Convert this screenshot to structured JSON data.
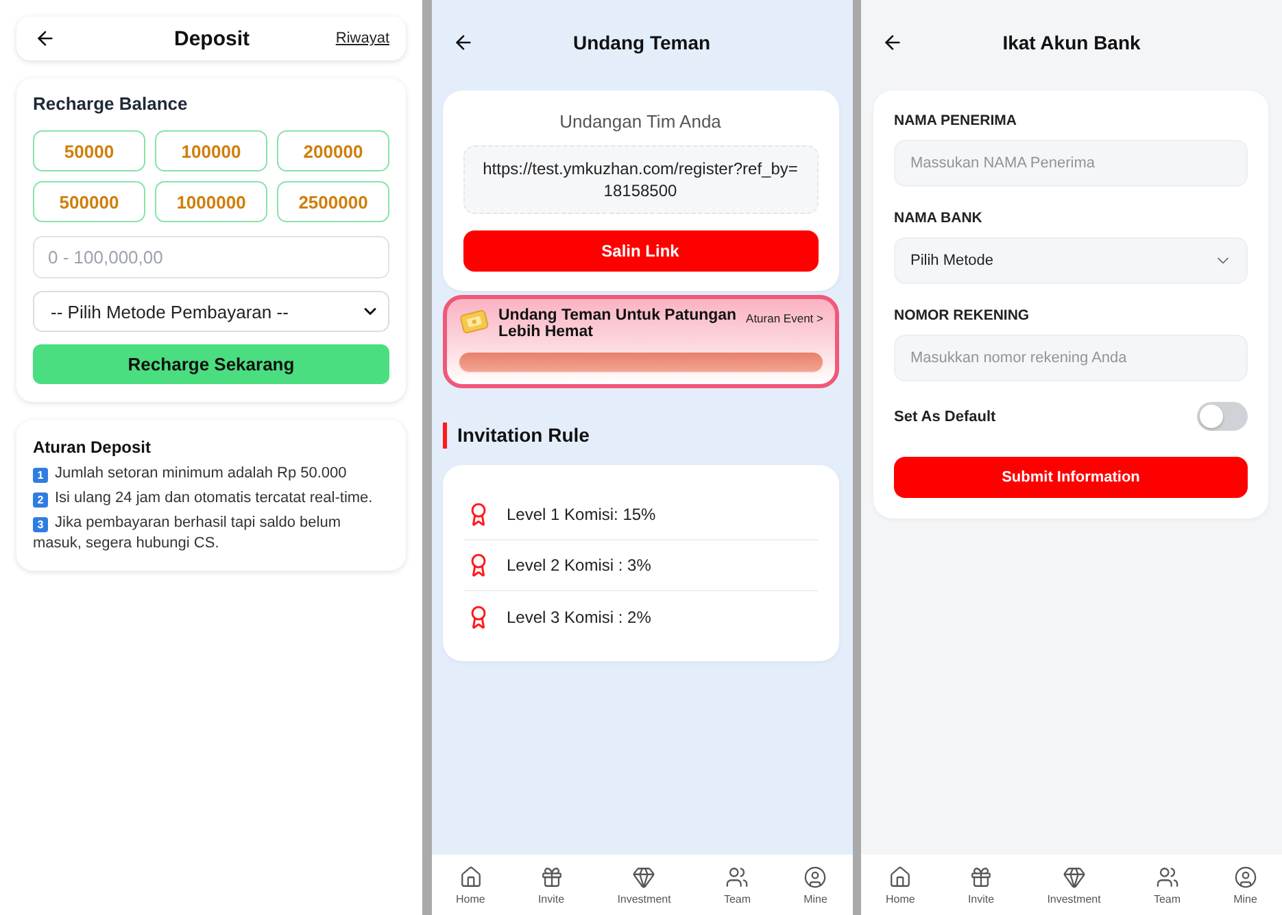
{
  "deposit_screen": {
    "header": {
      "title": "Deposit",
      "history_link": "Riwayat"
    },
    "recharge_card": {
      "title": "Recharge Balance",
      "amounts": [
        {
          "label": "50000",
          "selected": false
        },
        {
          "label": "100000",
          "selected": false
        },
        {
          "label": "200000",
          "selected": false
        },
        {
          "label": "500000",
          "selected": false
        },
        {
          "label": "1000000",
          "selected": false
        },
        {
          "label": "2500000",
          "selected": false
        }
      ],
      "amount_field": {
        "placeholder": "0 - 100,000,00"
      },
      "payment_method": {
        "value": "-- Pilih Metode Pembayaran --"
      },
      "submit_button": "Recharge Sekarang"
    },
    "rules_card": {
      "title": "Aturan Deposit",
      "items": [
        {
          "number": "1",
          "text": "Jumlah setoran minimum adalah Rp 50.000"
        },
        {
          "number": "2",
          "text": "Isi ulang 24 jam dan otomatis tercatat real-time."
        },
        {
          "number": "3",
          "text": "Jika pembayaran berhasil tapi saldo belum masuk, segera hubungi CS."
        }
      ]
    }
  },
  "invite_screen": {
    "header": {
      "title": "Undang Teman"
    },
    "invite_card": {
      "title": "Undangan Tim Anda",
      "link": "https://test.ymkuzhan.com/register?ref_by=18158500",
      "copy_button": "Salin Link"
    },
    "event_banner": {
      "title": "Undang Teman Untuk Patungan Lebih Hemat",
      "rules_link": "Aturan Event >",
      "level": 1
    },
    "invitation_rule": {
      "title": "Invitation Rule",
      "items": [
        "Level 1 Komisi: 15%",
        "Level 2 Komisi : 3%",
        "Level 3 Komisi : 2%"
      ]
    },
    "nav": [
      {
        "kind": "home",
        "label": "Home",
        "selected": false
      },
      {
        "kind": "invite",
        "label": "Invite",
        "selected": false
      },
      {
        "kind": "investment",
        "label": "Investment",
        "selected": false
      },
      {
        "kind": "team",
        "label": "Team",
        "selected": false
      },
      {
        "kind": "mine",
        "label": "Mine",
        "selected": false
      }
    ]
  },
  "bank_screen": {
    "header": {
      "title": "Ikat Akun Bank"
    },
    "form": {
      "fields": [
        {
          "kind": "input",
          "label": "NAMA PENERIMA",
          "placeholder": "Massukan NAMA Penerima"
        },
        {
          "kind": "select",
          "label": "NAMA BANK",
          "value": "Pilih Metode"
        },
        {
          "kind": "input",
          "label": "NOMOR REKENING",
          "placeholder": "Masukkan nomor rekening Anda"
        }
      ],
      "default_toggle": {
        "label": "Set As Default",
        "on": false
      },
      "submit_button": "Submit Information"
    },
    "nav": [
      {
        "kind": "home",
        "label": "Home",
        "selected": false
      },
      {
        "kind": "invite",
        "label": "Invite",
        "selected": false
      },
      {
        "kind": "investment",
        "label": "Investment",
        "selected": false
      },
      {
        "kind": "team",
        "label": "Team",
        "selected": false
      },
      {
        "kind": "mine",
        "label": "Mine",
        "selected": false
      }
    ]
  }
}
